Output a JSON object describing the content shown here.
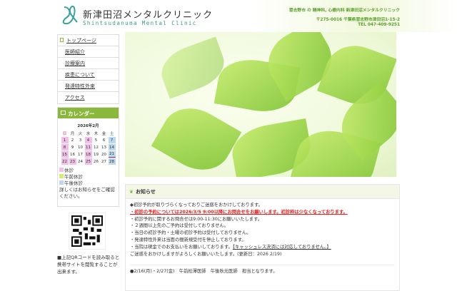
{
  "header": {
    "title_jp": "新津田沼メンタルクリニック",
    "title_en": "Shintsudanuma Mental Clinic",
    "tagline": "習志野市 の 精神科, 心療内科 新津田沼メンタルクリニック",
    "address": "〒275-0016 千葉県習志野市津田沼1-15-2",
    "tel": "TEL 047-409-9251"
  },
  "nav": [
    "トップページ",
    "医師紹介",
    "診療案内",
    "疾患について",
    "発達特性外来",
    "アクセス"
  ],
  "calendar": {
    "heading": "カレンダー",
    "month": "2026年2月",
    "weekdays": [
      "日",
      "月",
      "火",
      "水",
      "木",
      "金",
      "土"
    ],
    "weeks": [
      [
        "1",
        "2",
        "3",
        "4",
        "5",
        "6",
        "7"
      ],
      [
        "8",
        "9",
        "10",
        "11",
        "12",
        "13",
        "14"
      ],
      [
        "15",
        "16",
        "17",
        "18",
        "19",
        "20",
        "21"
      ],
      [
        "22",
        "23",
        "24",
        "25",
        "26",
        "27",
        "28"
      ]
    ],
    "legend": [
      "休診",
      "午前休診",
      "午後休診"
    ],
    "note": "詳しくはお知らせをご確認ください。",
    "colors": {
      "closed": "#f0c0e8",
      "am": "#d8ec70",
      "pm": "#bcd8ee"
    }
  },
  "qr_note": "■上記QRコードを読み取ると携帯サイトを閲覧することが出来ます。",
  "news": {
    "heading": "お知らせ",
    "lines": [
      "◆初診予約が取りづらくなっておりご迷惑をおかけしております。",
      "・初診の予約については2026/3/5 9:00以降にお問合せをお願いします。初診枠は少なくなっております。",
      "・初診予約に関するお問合せは9:00-11:30にお願いいたします。",
      "・２週間以上先のご予約は受付しておりません。",
      "・当日の初診予約・土曜の初診予約は受付しておりません。",
      "・発達特性外来は当面の間新規受付を停止しております。",
      "・当院は現金でのお支払いをお願いしております。",
      "【キャッシュレス決済には対応しておりません。】",
      "ご迷惑をおかけしますがよろしくお願いいたします。(更新日：2026 2/19)",
      "●2/16(月)・2/27(金)　午前松澤医師　午後秋元医師　担当となります。"
    ]
  }
}
